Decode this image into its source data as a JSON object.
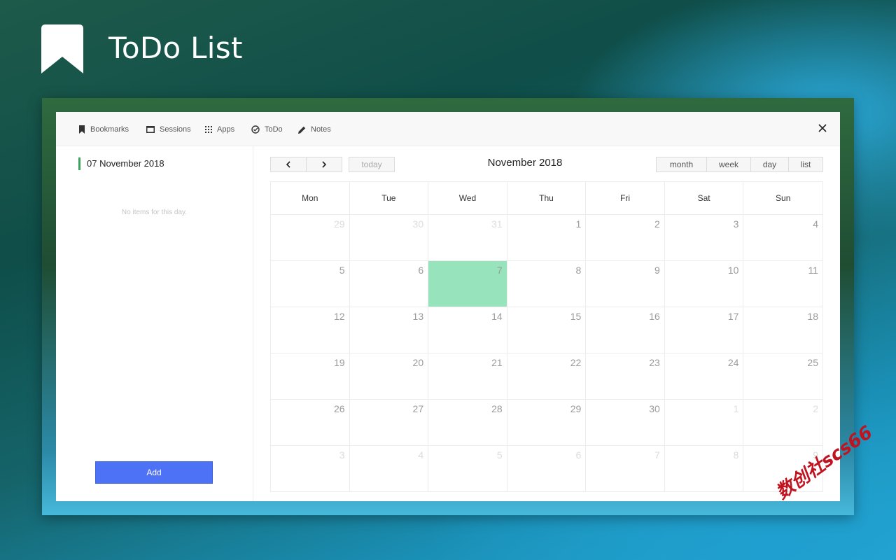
{
  "hero": {
    "title": "ToDo List"
  },
  "nav": {
    "items": [
      {
        "label": "Bookmarks",
        "icon": "bookmark-icon"
      },
      {
        "label": "Sessions",
        "icon": "window-icon"
      },
      {
        "label": "Apps",
        "icon": "apps-grid-icon"
      },
      {
        "label": "ToDo",
        "icon": "check-circle-icon"
      },
      {
        "label": "Notes",
        "icon": "pencil-icon"
      }
    ]
  },
  "sidebar": {
    "selected_date": "07 November 2018",
    "empty_message": "No items for this day.",
    "add_label": "Add"
  },
  "calendar": {
    "title": "November 2018",
    "today_label": "today",
    "views": [
      "month",
      "week",
      "day",
      "list"
    ],
    "weekdays": [
      "Mon",
      "Tue",
      "Wed",
      "Thu",
      "Fri",
      "Sat",
      "Sun"
    ],
    "weeks": [
      [
        "29",
        "30",
        "31",
        "1",
        "2",
        "3",
        "4"
      ],
      [
        "5",
        "6",
        "7",
        "8",
        "9",
        "10",
        "11"
      ],
      [
        "12",
        "13",
        "14",
        "15",
        "16",
        "17",
        "18"
      ],
      [
        "19",
        "20",
        "21",
        "22",
        "23",
        "24",
        "25"
      ],
      [
        "26",
        "27",
        "28",
        "29",
        "30",
        "1",
        "2"
      ],
      [
        "3",
        "4",
        "5",
        "6",
        "7",
        "8",
        "9"
      ]
    ],
    "today_cell": [
      1,
      2
    ],
    "accent_color": "#97e3bb"
  },
  "watermark": "数创社scs66"
}
